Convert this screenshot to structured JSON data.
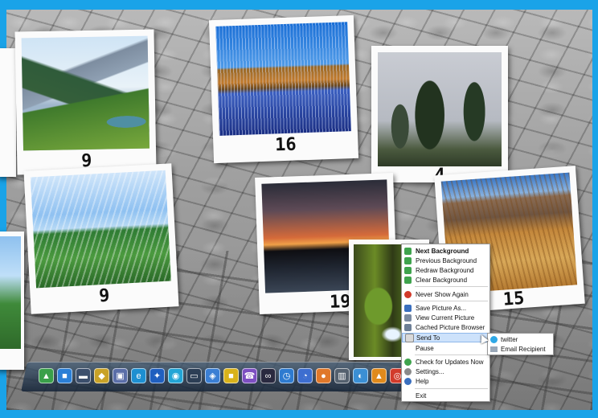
{
  "photos": [
    {
      "label": "9"
    },
    {
      "label": "16"
    },
    {
      "label": "4"
    },
    {
      "label": "9"
    },
    {
      "label": "19"
    },
    {
      "label": "15"
    }
  ],
  "context_menu": {
    "items": [
      {
        "label": "Next Background",
        "icon": "next-background-icon"
      },
      {
        "label": "Previous Background",
        "icon": "previous-background-icon"
      },
      {
        "label": "Redraw Background",
        "icon": "redraw-icon"
      },
      {
        "label": "Clear Background",
        "icon": "clear-icon"
      },
      {
        "label": "Never Show Again",
        "icon": "block-icon"
      },
      {
        "label": "Save Picture As...",
        "icon": "save-icon"
      },
      {
        "label": "View Current Picture",
        "icon": "view-picture-icon"
      },
      {
        "label": "Cached Picture Browser",
        "icon": "browser-icon"
      },
      {
        "label": "Send To",
        "icon": "send-icon"
      },
      {
        "label": "Pause",
        "icon": "pause-icon"
      },
      {
        "label": "Check for Updates Now",
        "icon": "update-icon"
      },
      {
        "label": "Settings...",
        "icon": "settings-icon"
      },
      {
        "label": "Help",
        "icon": "help-icon"
      },
      {
        "label": "Exit",
        "icon": ""
      }
    ],
    "send_to_submenu": [
      {
        "label": "twitter",
        "icon": "twitter-icon"
      },
      {
        "label": "Email Recipient",
        "icon": "email-icon"
      }
    ]
  },
  "dock_icons": [
    "app-icon-1",
    "app-icon-2",
    "app-icon-3",
    "app-icon-4",
    "app-icon-5",
    "app-icon-6",
    "app-icon-7",
    "app-icon-8",
    "app-icon-9",
    "app-icon-10",
    "app-icon-11",
    "app-icon-12",
    "app-icon-13",
    "app-icon-14",
    "app-icon-15",
    "app-icon-16",
    "app-icon-17",
    "app-icon-18",
    "app-icon-19",
    "app-icon-20"
  ],
  "colors": {
    "frame": "#1aa3e8",
    "menu_highlight": "#cde2fb"
  }
}
